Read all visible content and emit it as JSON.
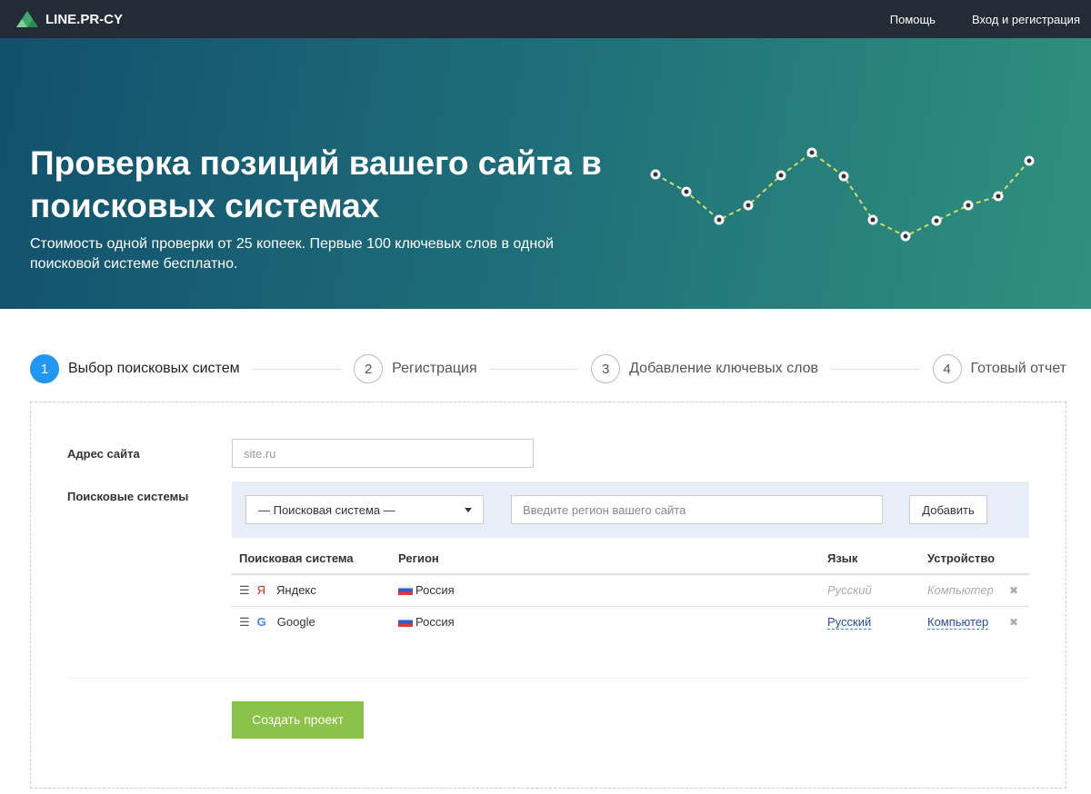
{
  "header": {
    "logo": "LINE.PR-CY",
    "nav": [
      "Помощь",
      "Вход и регистрация"
    ]
  },
  "hero": {
    "title": "Проверка позиций вашего сайта в поисковых системах",
    "subtitle": "Стоимость одной проверки от 25 копеек. Первые 100 ключевых слов в одной поисковой системе бесплатно."
  },
  "steps": [
    {
      "num": "1",
      "label": "Выбор поисковых систем"
    },
    {
      "num": "2",
      "label": "Регистрация"
    },
    {
      "num": "3",
      "label": "Добавление ключевых слов"
    },
    {
      "num": "4",
      "label": "Готовый отчет"
    }
  ],
  "form": {
    "site_label": "Адрес сайта",
    "site_placeholder": "site.ru",
    "engines_label": "Поисковые системы",
    "engine_select": "— Поисковая система —",
    "region_placeholder": "Введите регион вашего сайта",
    "add_button": "Добавить",
    "create_button": "Создать проект"
  },
  "table": {
    "headers": [
      "Поисковая система",
      "Регион",
      "Язык",
      "Устройство"
    ],
    "rows": [
      {
        "engine": "Яндекс",
        "icon": "Я",
        "region": "Россия",
        "lang": "Русский",
        "device": "Компьютер"
      },
      {
        "engine": "Google",
        "icon": "G",
        "region": "Россия",
        "lang": "Русский",
        "device": "Компьютер"
      }
    ]
  },
  "colors": {
    "accent": "#2196f3",
    "create": "#8bc34a",
    "header": "#232b36"
  }
}
